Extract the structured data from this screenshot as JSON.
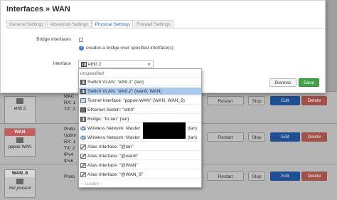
{
  "modal": {
    "title": "Interfaces » WAN",
    "tabs": [
      "General Settings",
      "Advanced Settings",
      "Physical Settings",
      "Firewall Settings"
    ],
    "bridge_label": "Bridge interfaces",
    "bridge_help": "creates a bridge over specified interface(s)",
    "interface_label": "Interface",
    "interface_value": "eth0.2",
    "dismiss_label": "Dismiss",
    "save_label": "Save"
  },
  "dropdown": {
    "options": [
      {
        "label": "unspecified",
        "icon": "none"
      },
      {
        "label": "Switch VLAN: \"eth0.1\" (lan)",
        "icon": "network-icon"
      },
      {
        "label": "Switch VLAN: \"eth0.2\" (wan6, WAN)",
        "icon": "network-icon"
      },
      {
        "label": "Tunnel Interface: \"pppoe-WAN\" (WAN, WAN_6)",
        "icon": "tunnel-icon"
      },
      {
        "label": "Ethernet Switch: \"eth0\"",
        "icon": "ethernet-icon"
      },
      {
        "label": "Bridge: \"br-lan\" (lan)",
        "icon": "bridge-icon"
      },
      {
        "label": "Wireless Network: Master",
        "icon": "wireless-icon"
      },
      {
        "label": "Wireless Network: Master",
        "icon": "wireless-icon"
      },
      {
        "label": "Alias Interface: \"@lan\"",
        "icon": "alias-icon"
      },
      {
        "label": "Alias Interface: \"@wan6\"",
        "icon": "alias-icon"
      },
      {
        "label": "Alias Interface: \"@WAN\"",
        "icon": "alias-icon"
      },
      {
        "label": "Alias Interface: \"@WAN_6\"",
        "icon": "alias-icon"
      },
      {
        "label": "-- custom --",
        "icon": "none"
      }
    ],
    "wireless_suffix_1": "(lan)",
    "wireless_suffix_2": "(lan)"
  },
  "background": {
    "rows": [
      {
        "name": "",
        "device": "eth0.2",
        "color": "#7fb26f",
        "stats": [
          "MAC",
          "RX: 1",
          "TX: 2"
        ]
      },
      {
        "name": "WAN",
        "device": "pppoe-WAN",
        "color": "#d46b6b",
        "stats": [
          "Proto",
          "Uptim",
          "RX: 1",
          "TX: 2",
          "IPv4",
          "IPv6"
        ]
      },
      {
        "name": "WAN_6",
        "device": "Not present",
        "color": "#c9c9c9",
        "stats": [
          "Proto"
        ]
      }
    ],
    "restart_label": "Restart",
    "stop_label": "Stop",
    "edit_label": "Edit",
    "delete_label": "Delete"
  }
}
